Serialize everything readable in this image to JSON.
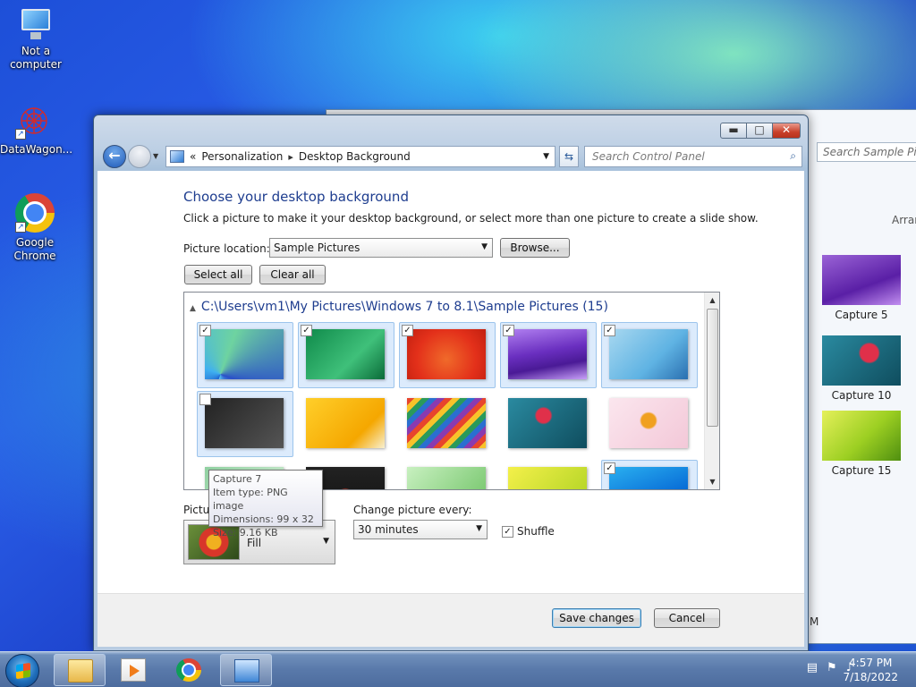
{
  "desktop": {
    "icons": [
      {
        "label": "Not a computer",
        "icon": "computer-icon"
      },
      {
        "label": "DataWagon...",
        "icon": "datawagon-icon"
      },
      {
        "label": "Google Chrome",
        "icon": "chrome-icon"
      }
    ]
  },
  "background_window": {
    "search_placeholder": "Search Sample Pictu",
    "arrange_text": "Arran",
    "items": [
      {
        "label": "Capture 5"
      },
      {
        "label": "Capture 10"
      },
      {
        "label": "Capture 15"
      }
    ],
    "bottom_text": "M"
  },
  "window": {
    "controls": {
      "minimize": "▬",
      "maximize": "□",
      "close": "✕"
    },
    "address": {
      "overflow": "«",
      "crumbs": [
        "Personalization",
        "Desktop Background"
      ],
      "separator": "▸"
    },
    "search_placeholder": "Search Control Panel",
    "heading": "Choose your desktop background",
    "subheading": "Click a picture to make it your desktop background, or select more than one picture to create a slide show.",
    "picture_location_label": "Picture location:",
    "picture_location_value": "Sample Pictures",
    "browse_label": "Browse...",
    "select_all_label": "Select all",
    "clear_all_label": "Clear all",
    "folder_header": "C:\\Users\\vm1\\My Pictures\\Windows 7 to 8.1\\Sample Pictures (15)",
    "tiles": [
      {
        "checked": true,
        "selected": true
      },
      {
        "checked": true,
        "selected": true
      },
      {
        "checked": true,
        "selected": true
      },
      {
        "checked": true,
        "selected": true
      },
      {
        "checked": true,
        "selected": true
      },
      {
        "checked": false,
        "selected": true
      },
      {
        "checked": false,
        "selected": false
      },
      {
        "checked": false,
        "selected": false
      },
      {
        "checked": false,
        "selected": false
      },
      {
        "checked": false,
        "selected": false
      },
      {
        "checked": false,
        "selected": false
      },
      {
        "checked": false,
        "selected": false
      },
      {
        "checked": false,
        "selected": false
      },
      {
        "checked": false,
        "selected": false
      },
      {
        "checked": true,
        "selected": true
      }
    ],
    "check_mark": "✓",
    "tooltip": {
      "line1": "Capture 7",
      "line2": "Item type: PNG image",
      "line3": "Dimensions: 99 x 32",
      "line4": "Size: 9.16 KB"
    },
    "picture_position_label": "Picture position:",
    "picture_position_value": "Fill",
    "change_every_label": "Change picture every:",
    "change_every_value": "30 minutes",
    "shuffle_label": "Shuffle",
    "shuffle_checked": true,
    "save_label": "Save changes",
    "cancel_label": "Cancel"
  },
  "taskbar": {
    "time": "4:57 PM",
    "date": "7/18/2022"
  }
}
